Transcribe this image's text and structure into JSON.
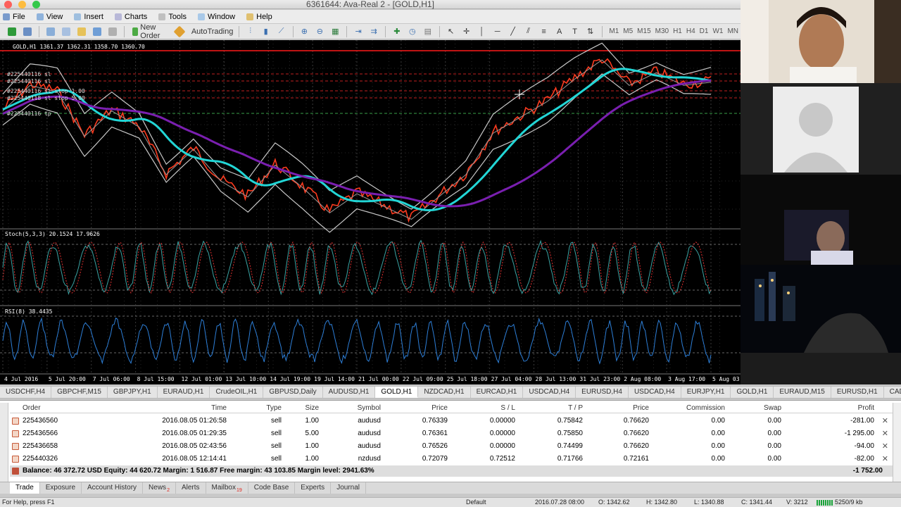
{
  "window": {
    "title": "6361644: Ava-Real 2 - [GOLD,H1]"
  },
  "menu": [
    {
      "label": "File",
      "color": "#7a9bcc"
    },
    {
      "label": "View",
      "color": "#8fb3dc"
    },
    {
      "label": "Insert",
      "color": "#9fbfdf"
    },
    {
      "label": "Charts",
      "color": "#b8b8d8"
    },
    {
      "label": "Tools",
      "color": "#c0c0c0"
    },
    {
      "label": "Window",
      "color": "#a9c9e8"
    },
    {
      "label": "Help",
      "color": "#e0c070"
    }
  ],
  "toolbar": {
    "new_order": "New Order",
    "autotrading": "AutoTrading",
    "timeframes": [
      "M1",
      "M5",
      "M15",
      "M30",
      "H1",
      "H4",
      "D1",
      "W1",
      "MN"
    ]
  },
  "chart": {
    "header": "GOLD,H1  1361.37 1362.31 1358.70 1360.70",
    "stoch_label": "Stoch(5,3,3) 20.1524 17.9626",
    "rsi_label": "RSI(8) 38.4435",
    "order_lines": [
      "#225440116 sl",
      "#225440116 sl",
      "#225440116 sl stop 1.00",
      "#225440118 sl stop 5.00",
      "#225440116 tp"
    ],
    "rsi_scale_max": "100",
    "rsi_scale_min": "0",
    "time_labels": [
      "4 Jul 2016",
      "5 Jul 20:00",
      "7 Jul 06:00",
      "8 Jul 15:00",
      "12 Jul 01:00",
      "13 Jul 10:00",
      "14 Jul 19:00",
      "19 Jul 14:00",
      "21 Jul 00:00",
      "22 Jul 09:00",
      "25 Jul 18:00",
      "27 Jul 04:00",
      "28 Jul 13:00",
      "31 Jul 23:00",
      "2 Aug 08:00",
      "3 Aug 17:00",
      "5 Aug 03:00"
    ],
    "colors": {
      "candles": "#ff3b1f",
      "ma_fast": "#22d6d6",
      "ma_slow": "#7a1fb0",
      "bollinger": "#c8c8c8",
      "stoch_main": "#3aa3a3",
      "stoch_signal": "#e03030",
      "rsi": "#2d7fd8",
      "level_line": "#ff1a1a"
    },
    "chart_data": {
      "type": "line",
      "series": [
        {
          "values": [
            1352,
            1360,
            1358,
            1344,
            1352,
            1347,
            1332,
            1340,
            1330,
            1325,
            1335,
            1328,
            1320,
            1326,
            1322,
            1318,
            1325,
            1332,
            1345,
            1350,
            1355,
            1362,
            1368,
            1360,
            1364,
            1360,
            1361
          ]
        }
      ]
    }
  },
  "cams": {
    "live_badge": ""
  },
  "chart_tabs": [
    "USDCHF,H4",
    "GBPCHF,M15",
    "GBPJPY,H1",
    "EURAUD,H1",
    "CrudeOIL,H1",
    "GBPUSD,Daily",
    "AUDUSD,H1",
    "GOLD,H1",
    "NZDCAD,H1",
    "EURCAD,H1",
    "USDCAD,H4",
    "EURUSD,H4",
    "USDCAD,H4",
    "EURJPY,H1",
    "GOLD,H1",
    "EURAUD,M15",
    "EURUSD,H1",
    "CADJP"
  ],
  "chart_tabs_active": 7,
  "terminal": {
    "columns": [
      "Order",
      "Time",
      "Type",
      "Size",
      "Symbol",
      "Price",
      "S / L",
      "T / P",
      "Price",
      "Commission",
      "Swap",
      "Profit"
    ],
    "rows": [
      {
        "order": "225436560",
        "time": "2016.08.05 01:26:58",
        "type": "sell",
        "size": "1.00",
        "symbol": "audusd",
        "price": "0.76339",
        "sl": "0.00000",
        "tp": "0.75842",
        "price2": "0.76620",
        "commission": "0.00",
        "swap": "0.00",
        "profit": "-281.00"
      },
      {
        "order": "225436566",
        "time": "2016.08.05 01:29:35",
        "type": "sell",
        "size": "5.00",
        "symbol": "audusd",
        "price": "0.76361",
        "sl": "0.00000",
        "tp": "0.75850",
        "price2": "0.76620",
        "commission": "0.00",
        "swap": "0.00",
        "profit": "-1 295.00"
      },
      {
        "order": "225436658",
        "time": "2016.08.05 02:43:56",
        "type": "sell",
        "size": "1.00",
        "symbol": "audusd",
        "price": "0.76526",
        "sl": "0.00000",
        "tp": "0.74499",
        "price2": "0.76620",
        "commission": "0.00",
        "swap": "0.00",
        "profit": "-94.00"
      },
      {
        "order": "225440326",
        "time": "2016.08.05 12:14:41",
        "type": "sell",
        "size": "1.00",
        "symbol": "nzdusd",
        "price": "0.72079",
        "sl": "0.72512",
        "tp": "0.71766",
        "price2": "0.72161",
        "commission": "0.00",
        "swap": "0.00",
        "profit": "-82.00"
      }
    ],
    "balance": "Balance: 46 372.72 USD  Equity: 44 620.72  Margin: 1 516.87  Free margin: 43 103.85  Margin level: 2941.63%",
    "total_profit": "-1 752.00",
    "tabs": [
      "Trade",
      "Exposure",
      "Account History",
      "News",
      "Alerts",
      "Mailbox",
      "Code Base",
      "Experts",
      "Journal"
    ],
    "news_badge": "2",
    "mailbox_badge": "19",
    "active_tab": 0
  },
  "status": {
    "help": "For Help, press F1",
    "profile": "Default",
    "datetime": "2016.07.28 08:00",
    "open": "O: 1342.62",
    "high": "H: 1342.80",
    "low": "L: 1340.88",
    "close": "C: 1341.44",
    "volume": "V: 3212",
    "traffic": "5250/9 kb"
  }
}
